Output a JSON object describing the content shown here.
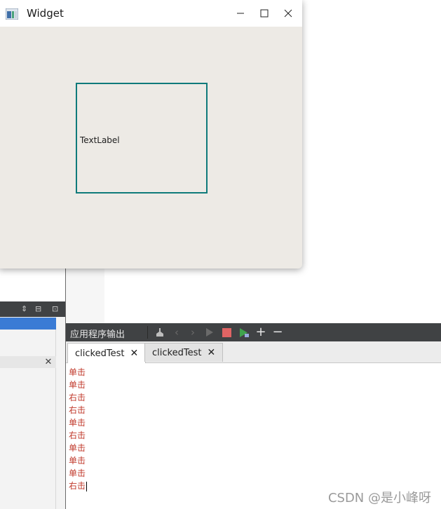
{
  "window": {
    "title": "Widget",
    "label_text": "TextLabel",
    "border_color": "#0f7a7a"
  },
  "output_pane": {
    "title": "应用程序输出",
    "tabs": [
      {
        "label": "clickedTest",
        "active": true
      },
      {
        "label": "clickedTest",
        "active": false
      }
    ],
    "lines": [
      "单击",
      "单击",
      "右击",
      "右击",
      "单击",
      "右击",
      "单击",
      "单击",
      "单击",
      "右击"
    ],
    "text_color": "#c0392b"
  },
  "watermark": "CSDN @是小峰呀",
  "icons": {
    "minimize": "minimize-icon",
    "maximize": "maximize-icon",
    "close": "close-icon",
    "clear": "clear-output-icon",
    "prev": "previous-icon",
    "next": "next-icon",
    "run": "run-icon",
    "stop": "stop-icon",
    "debug": "debug-run-icon",
    "zoom_in": "zoom-in-icon",
    "zoom_out": "zoom-out-icon"
  }
}
